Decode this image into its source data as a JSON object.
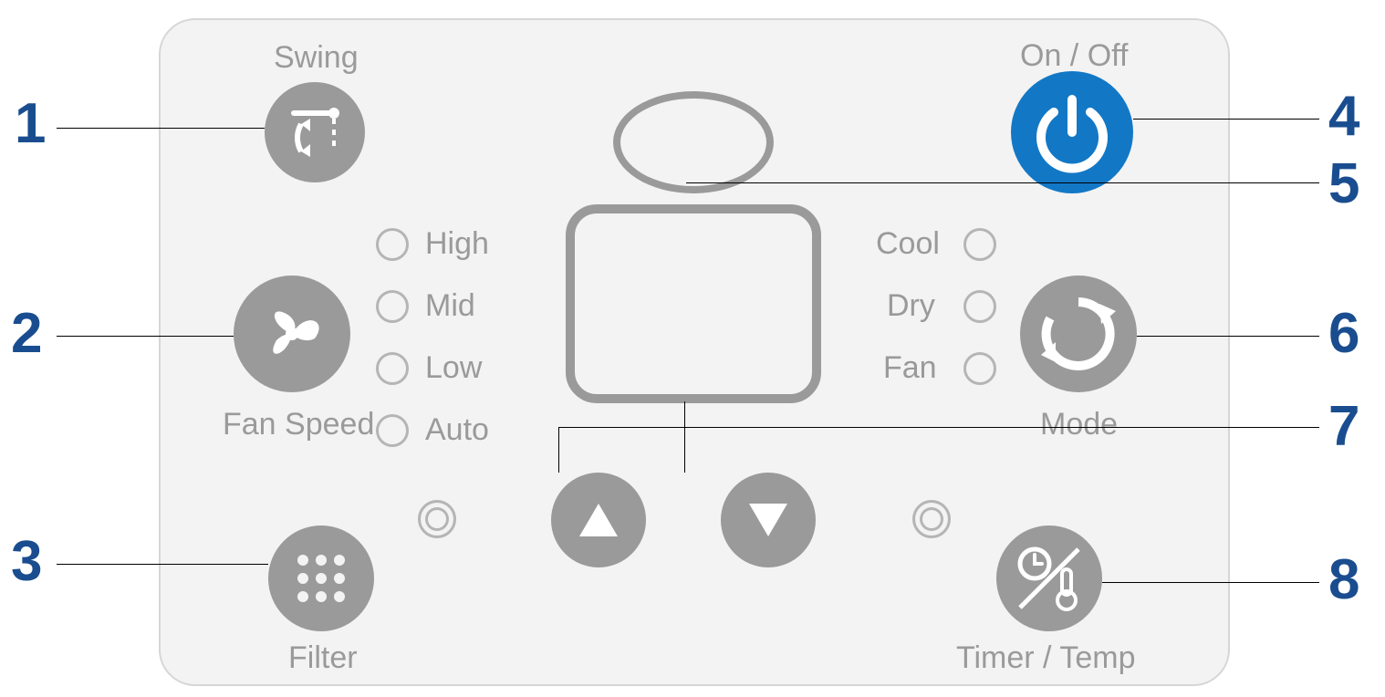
{
  "labels": {
    "swing": "Swing",
    "onoff": "On / Off",
    "fan_speed": "Fan Speed",
    "mode": "Mode",
    "filter": "Filter",
    "timer_temp": "Timer / Temp"
  },
  "fan_levels": [
    "High",
    "Mid",
    "Low",
    "Auto"
  ],
  "modes": [
    "Cool",
    "Dry",
    "Fan"
  ],
  "callouts": [
    "1",
    "2",
    "3",
    "4",
    "5",
    "6",
    "7",
    "8"
  ],
  "colors": {
    "accent": "#1278c6",
    "neutral": "#9a9a9a",
    "panel": "#f3f3f3",
    "label": "#1a4d8f"
  }
}
